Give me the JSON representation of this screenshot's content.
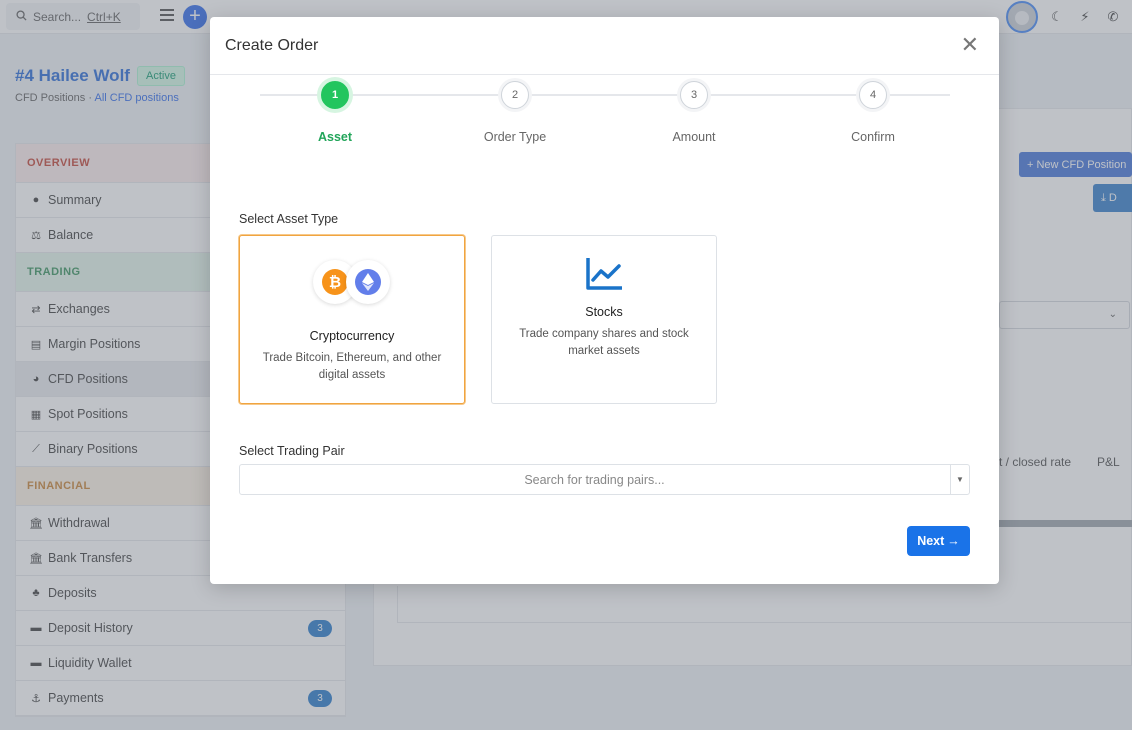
{
  "topbar": {
    "search_label": "Search...",
    "search_shortcut": "Ctrl+K"
  },
  "profile": {
    "title": "#4 Hailee Wolf",
    "status": "Active",
    "breadcrumb_current": "CFD Positions",
    "breadcrumb_separator": "·",
    "breadcrumb_link": "All CFD positions"
  },
  "sidebar": {
    "sections": {
      "overview": "OVERVIEW",
      "trading": "TRADING",
      "financial": "FINANCIAL"
    },
    "items": {
      "summary": "Summary",
      "balance": "Balance",
      "exchanges": "Exchanges",
      "margin_positions": "Margin Positions",
      "cfd_positions": "CFD Positions",
      "spot_positions": "Spot Positions",
      "binary_positions": "Binary Positions",
      "withdrawal": "Withdrawal",
      "bank_transfers": "Bank Transfers",
      "deposits": "Deposits",
      "deposit_history": "Deposit History",
      "liquidity_wallet": "Liquidity Wallet",
      "payments": "Payments"
    },
    "badges": {
      "deposit_history": "3",
      "payments": "3"
    }
  },
  "background": {
    "new_button": "+ New CFD Position",
    "download_button": "D",
    "table_headers": {
      "rate": "t / closed rate",
      "pnl": "P&L"
    }
  },
  "modal": {
    "title": "Create Order",
    "close_symbol": "✕",
    "steps": [
      {
        "number": "1",
        "label": "Asset",
        "active": true
      },
      {
        "number": "2",
        "label": "Order Type",
        "active": false
      },
      {
        "number": "3",
        "label": "Amount",
        "active": false
      },
      {
        "number": "4",
        "label": "Confirm",
        "active": false
      }
    ],
    "asset_type_label": "Select Asset Type",
    "asset_options": [
      {
        "title": "Cryptocurrency",
        "description": "Trade Bitcoin, Ethereum, and other digital assets",
        "selected": true,
        "icons": [
          "bitcoin-icon",
          "ethereum-icon"
        ]
      },
      {
        "title": "Stocks",
        "description": "Trade company shares and stock market assets",
        "selected": false,
        "icons": [
          "line-chart-icon"
        ]
      }
    ],
    "trading_pair_label": "Select Trading Pair",
    "trading_pair_placeholder": "Search for trading pairs...",
    "next_label": "Next"
  },
  "colors": {
    "primary": "#1a73e8",
    "step_active": "#22c55e",
    "selected_card_border": "#f0a440",
    "bitcoin": "#f7931a",
    "ethereum": "#627eea",
    "stocks_icon": "#1a73c9"
  }
}
